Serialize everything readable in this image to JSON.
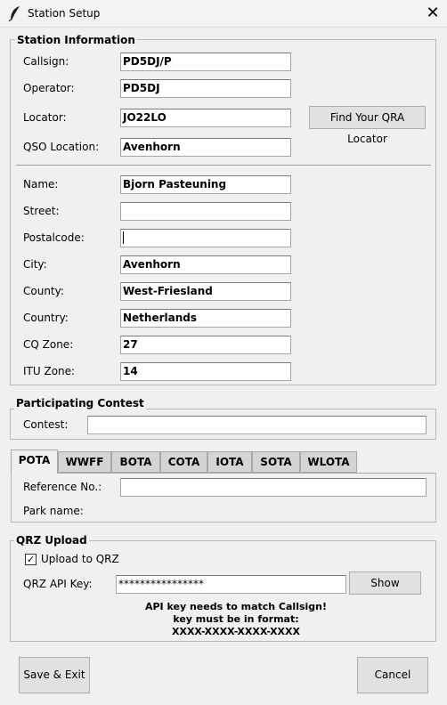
{
  "window": {
    "title": "Station Setup",
    "close_glyph": "✕",
    "icon": "feather-icon"
  },
  "station_info": {
    "legend": "Station Information",
    "callsign": {
      "label": "Callsign:",
      "value": "PD5DJ/P"
    },
    "operator": {
      "label": "Operator:",
      "value": "PD5DJ"
    },
    "locator": {
      "label": "Locator:",
      "value": "JO22LO"
    },
    "find_locator_button": "Find Your QRA Locator",
    "qso_location": {
      "label": "QSO Location:",
      "value": "Avenhorn"
    },
    "name": {
      "label": "Name:",
      "value": "Bjorn Pasteuning"
    },
    "street": {
      "label": "Street:",
      "value": ""
    },
    "postalcode": {
      "label": "Postalcode:",
      "value": ""
    },
    "city": {
      "label": "City:",
      "value": "Avenhorn"
    },
    "county": {
      "label": "County:",
      "value": "West-Friesland"
    },
    "country": {
      "label": "Country:",
      "value": "Netherlands"
    },
    "cq_zone": {
      "label": "CQ Zone:",
      "value": "27"
    },
    "itu_zone": {
      "label": "ITU Zone:",
      "value": "14"
    }
  },
  "contest": {
    "legend": "Participating Contest",
    "contest": {
      "label": "Contest:",
      "value": ""
    }
  },
  "program_tabs": {
    "tabs": [
      "POTA",
      "WWFF",
      "BOTA",
      "COTA",
      "IOTA",
      "SOTA",
      "WLOTA"
    ],
    "active": "POTA",
    "reference_label": "Reference No.:",
    "reference_value": "",
    "park_name_label": "Park name:"
  },
  "qrz": {
    "legend": "QRZ Upload",
    "upload_checkbox_label": "Upload to QRZ",
    "upload_checked": true,
    "api_key_label": "QRZ API Key:",
    "api_key_value": "****************",
    "show_button": "Show",
    "note_line1": "API key needs to match Callsign!",
    "note_line2": "key must be in format:",
    "note_line3": "XXXX-XXXX-XXXX-XXXX"
  },
  "footer": {
    "save_button": "Save & Exit",
    "cancel_button": "Cancel"
  }
}
